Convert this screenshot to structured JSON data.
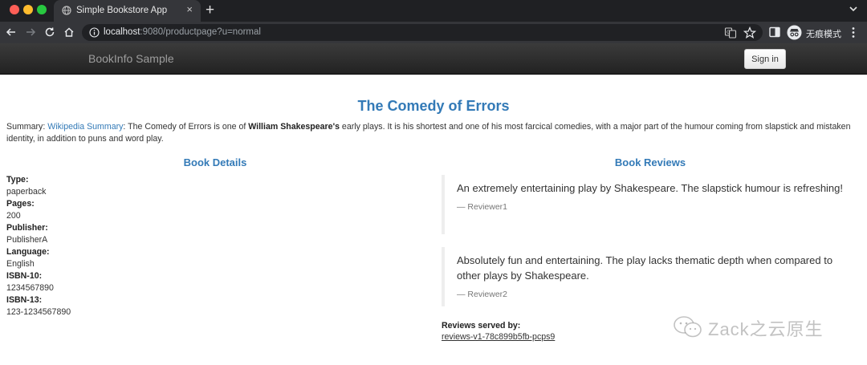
{
  "browser": {
    "tab_title": "Simple Bookstore App",
    "tab_close_glyph": "×",
    "new_tab_glyph": "+",
    "url_host": "localhost",
    "url_rest": ":9080/productpage?u=normal",
    "incognito_label": "无痕模式"
  },
  "navbar": {
    "brand": "BookInfo Sample",
    "signin_label": "Sign in"
  },
  "book": {
    "title": "The Comedy of Errors",
    "summary_prefix": "Summary: ",
    "summary_link": "Wikipedia Summary",
    "summary_mid": ": The Comedy of Errors is one of ",
    "summary_bold": "William Shakespeare's",
    "summary_rest": " early plays. It is his shortest and one of his most farcical comedies, with a major part of the humour coming from slapstick and mistaken identity, in addition to puns and word play."
  },
  "details": {
    "heading": "Book Details",
    "fields": [
      {
        "label": "Type:",
        "value": "paperback"
      },
      {
        "label": "Pages:",
        "value": "200"
      },
      {
        "label": "Publisher:",
        "value": "PublisherA"
      },
      {
        "label": "Language:",
        "value": "English"
      },
      {
        "label": "ISBN-10:",
        "value": "1234567890"
      },
      {
        "label": "ISBN-13:",
        "value": "123-1234567890"
      }
    ]
  },
  "reviews": {
    "heading": "Book Reviews",
    "items": [
      {
        "text": "An extremely entertaining play by Shakespeare. The slapstick humour is refreshing!",
        "author": "— Reviewer1"
      },
      {
        "text": "Absolutely fun and entertaining. The play lacks thematic depth when compared to other plays by Shakespeare.",
        "author": "— Reviewer2"
      }
    ],
    "served_by_label": "Reviews served by:",
    "served_by_value": "reviews-v1-78c899b5fb-pcps9"
  },
  "watermark": {
    "text": "Zack之云原生"
  },
  "colors": {
    "link_blue": "#337ab7",
    "navbar_dark": "#222222",
    "chrome_dark": "#35363a"
  }
}
